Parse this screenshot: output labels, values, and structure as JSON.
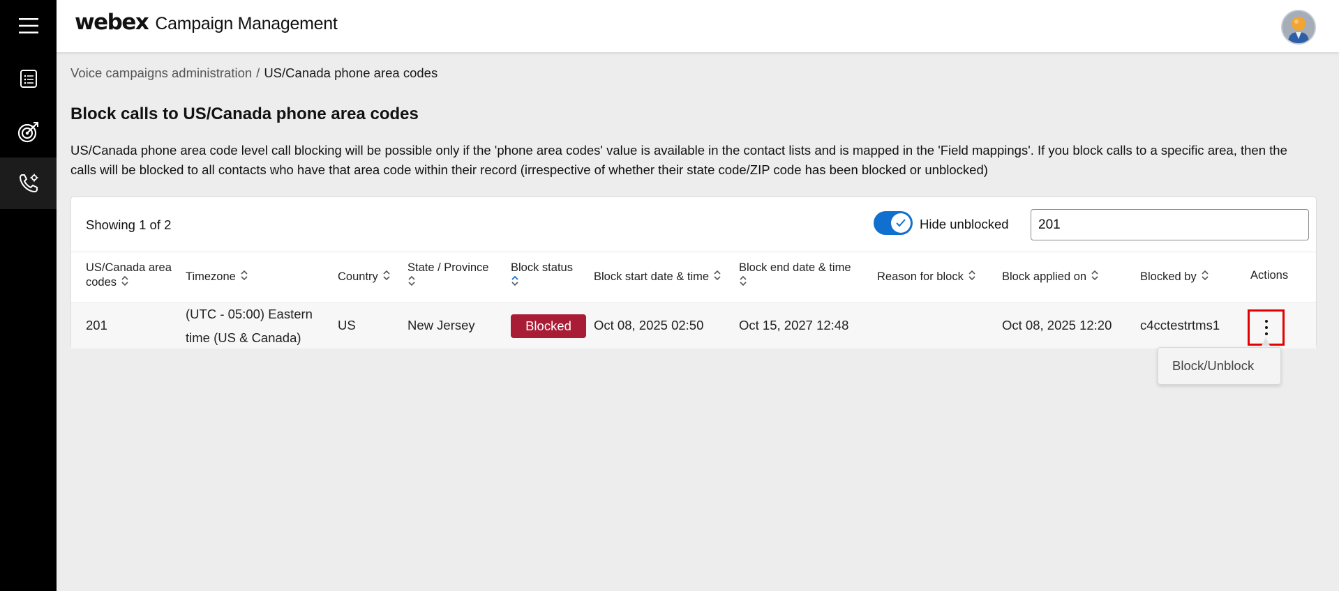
{
  "header": {
    "brand": "webex",
    "app_name": "Campaign Management"
  },
  "breadcrumb": {
    "parent": "Voice campaigns administration",
    "separator": "/",
    "current": "US/Canada phone area codes"
  },
  "page": {
    "title": "Block calls to US/Canada phone area codes",
    "description": "US/Canada phone area code level call blocking will be possible only if the 'phone area codes' value is available in the contact lists and is mapped in the 'Field mappings'. If you block calls to a specific area, then the calls will be blocked to all contacts who have that area code within their record (irrespective of whether their state code/ZIP code has been blocked or unblocked)"
  },
  "panel": {
    "showing": "Showing 1 of 2",
    "toggle_label": "Hide unblocked",
    "search_value": "201"
  },
  "table": {
    "columns": {
      "area_code_l1": "US/Canada area",
      "area_code_l2": "codes",
      "timezone": "Timezone",
      "country": "Country",
      "state": "State / Province",
      "block_status": "Block status",
      "start": "Block start date & time",
      "end_l1": "Block end date & time",
      "reason": "Reason for block",
      "applied": "Block applied on",
      "blocked_by": "Blocked by",
      "actions": "Actions"
    },
    "row": {
      "area_code": "201",
      "timezone_l1": "(UTC - 05:00) Eastern",
      "timezone_l2": "time (US & Canada)",
      "country": "US",
      "state": "New Jersey",
      "block_status": "Blocked",
      "start": "Oct 08, 2025 02:50",
      "end": "Oct 15, 2027 12:48",
      "reason": "",
      "applied": "Oct 08, 2025 12:20",
      "blocked_by": "c4cctestrtms1"
    }
  },
  "menu": {
    "item": "Block/Unblock"
  },
  "colors": {
    "rail": "#000000",
    "accent": "#1170cf",
    "blocked": "#a81c35",
    "highlight": "#e30000"
  }
}
